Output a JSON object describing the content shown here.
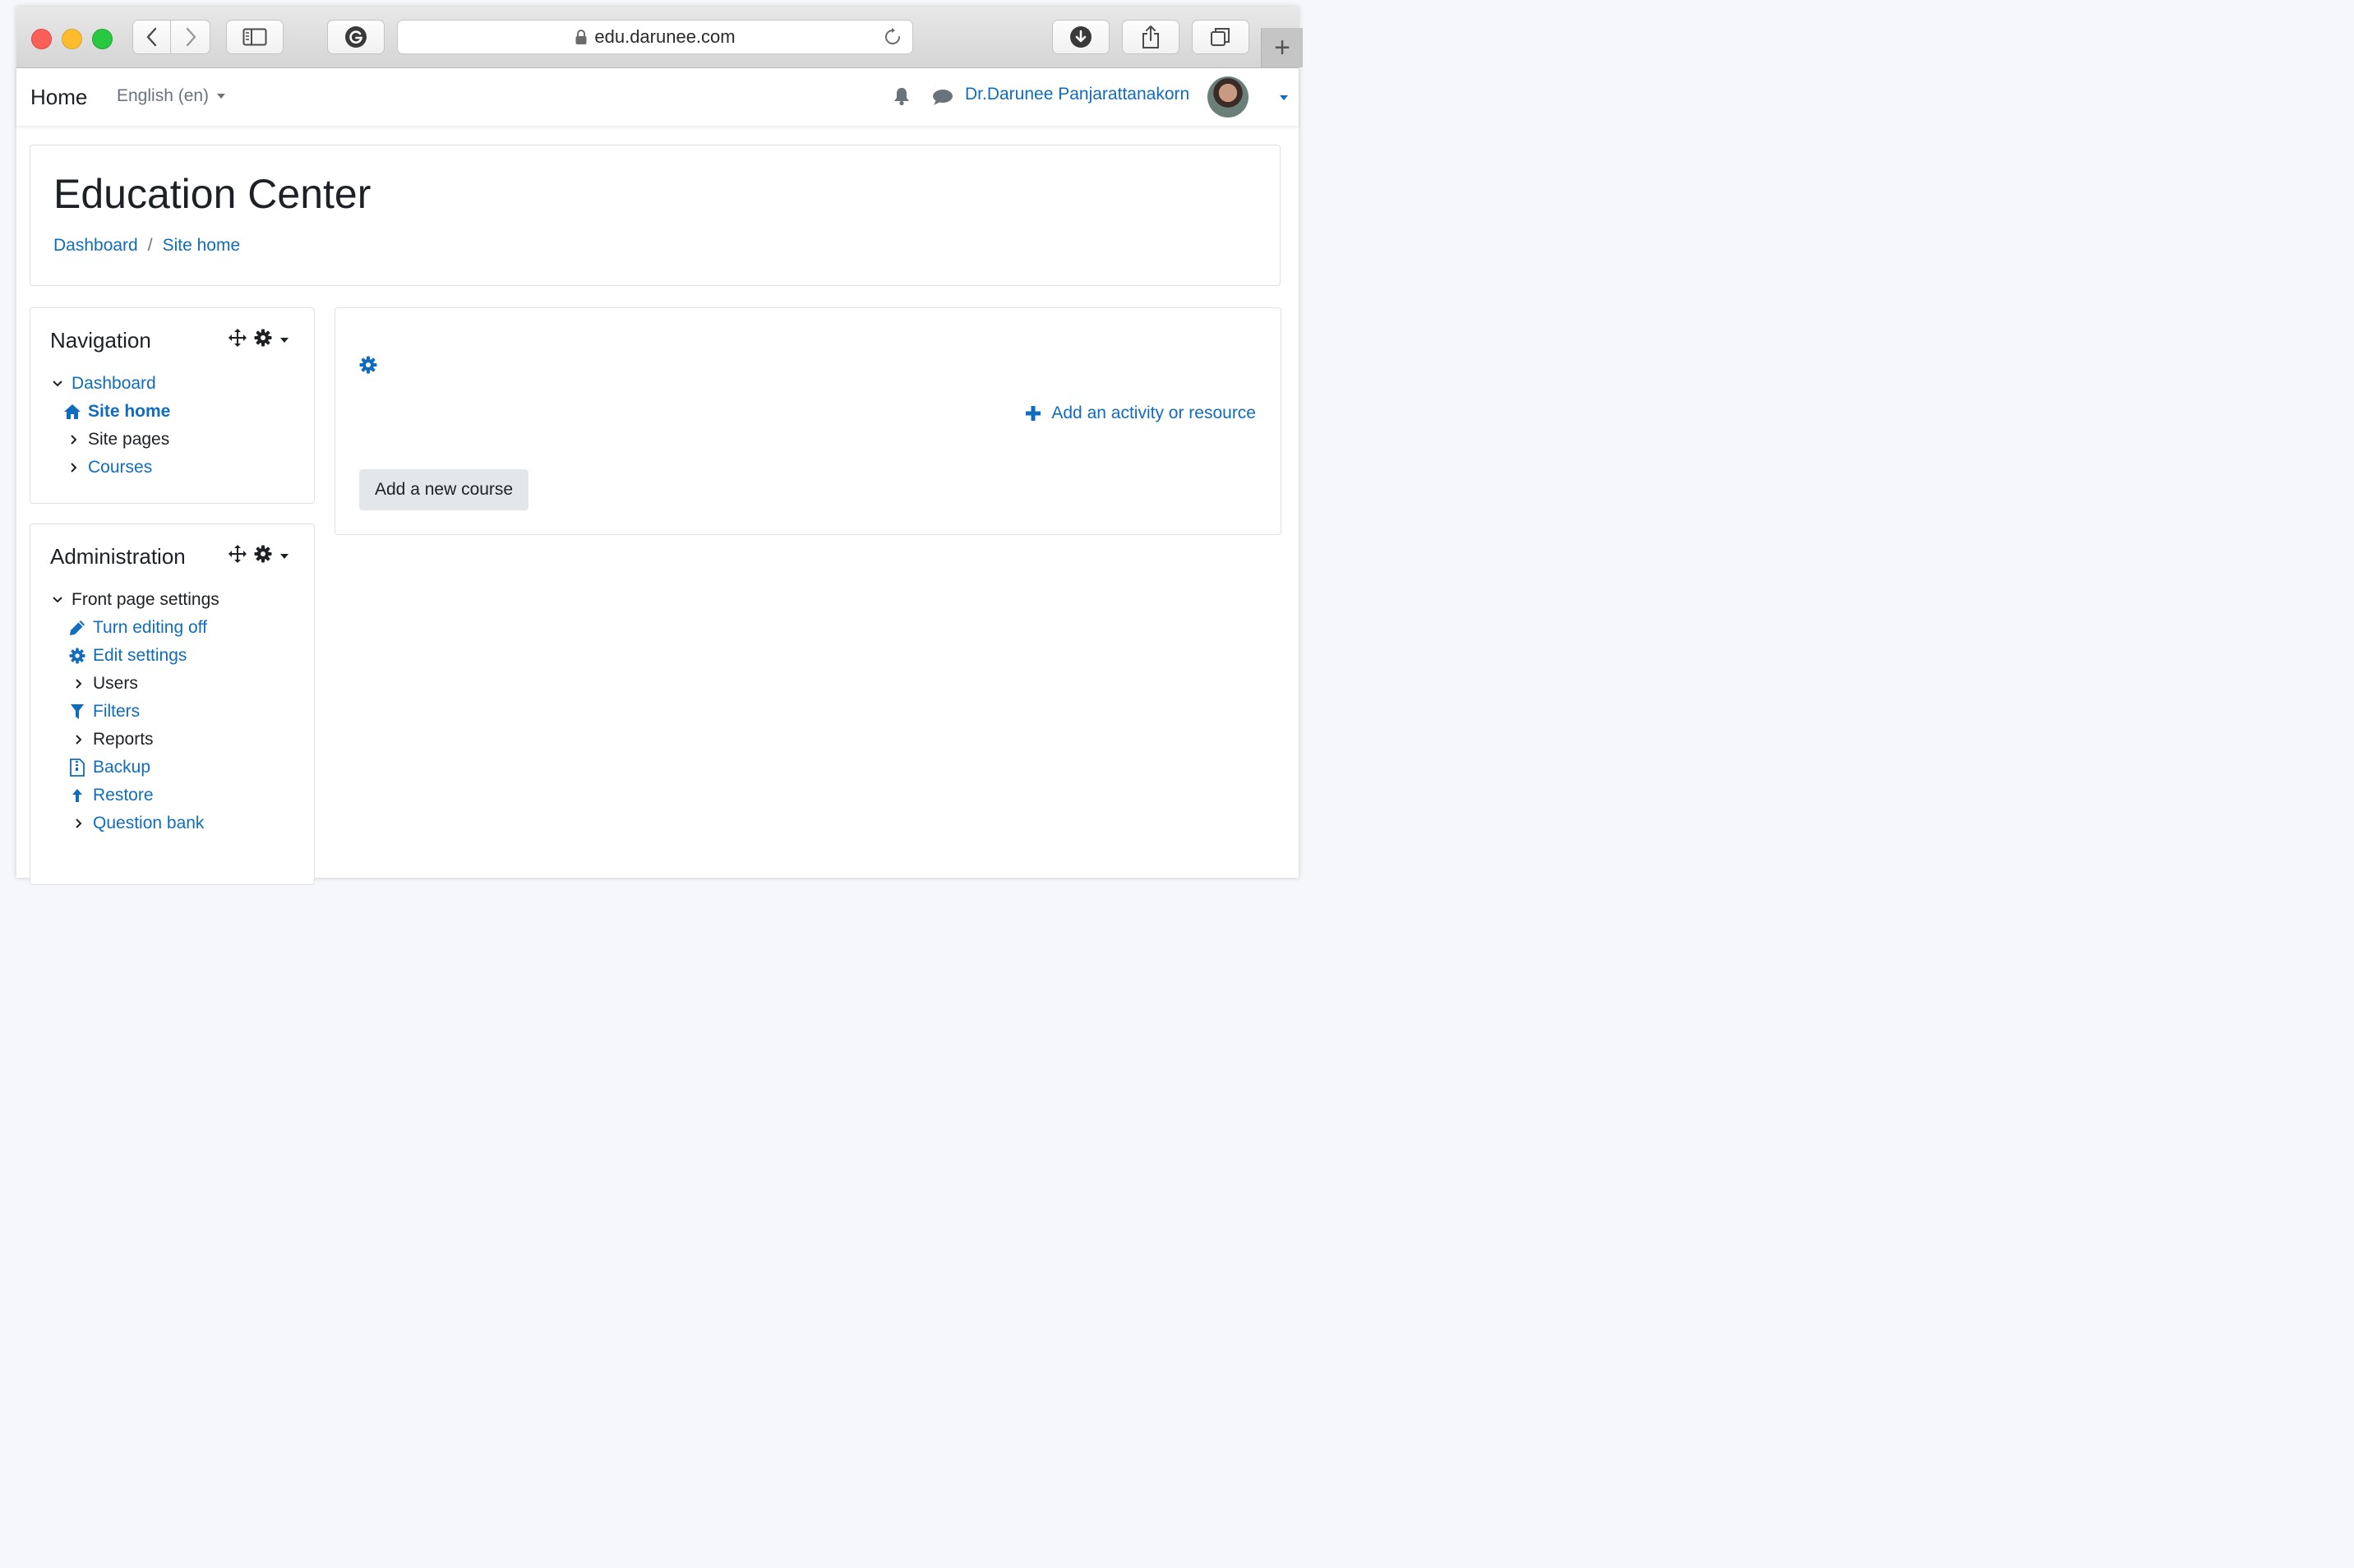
{
  "browser": {
    "url": "edu.darunee.com",
    "new_tab_glyph": "+",
    "icons": [
      "back-icon",
      "forward-icon",
      "sidebar-icon",
      "grammarly-icon",
      "lock-icon",
      "reload-icon",
      "download-icon",
      "share-icon",
      "tabs-icon"
    ]
  },
  "navbar": {
    "home": "Home",
    "language": "English (en)",
    "user_name": "Dr.Darunee Panjarattanakorn",
    "icons": [
      "bell-icon",
      "message-icon",
      "avatar",
      "chevron-down-icon"
    ]
  },
  "header": {
    "title": "Education Center",
    "breadcrumb": [
      {
        "label": "Dashboard"
      },
      {
        "label": "Site home"
      }
    ],
    "separator": "/"
  },
  "navigation_block": {
    "title": "Navigation",
    "items": [
      {
        "label": "Dashboard",
        "icon": "chevron-down-icon"
      },
      {
        "label": "Site home",
        "icon": "home-icon"
      },
      {
        "label": "Site pages",
        "icon": "chevron-right-icon"
      },
      {
        "label": "Courses",
        "icon": "chevron-right-icon"
      }
    ]
  },
  "admin_block": {
    "title": "Administration",
    "items": [
      {
        "label": "Front page settings",
        "icon": "chevron-down-icon"
      },
      {
        "label": "Turn editing off",
        "icon": "pencil-icon"
      },
      {
        "label": "Edit settings",
        "icon": "gear-icon"
      },
      {
        "label": "Users",
        "icon": "chevron-right-icon"
      },
      {
        "label": "Filters",
        "icon": "filter-icon"
      },
      {
        "label": "Reports",
        "icon": "chevron-right-icon"
      },
      {
        "label": "Backup",
        "icon": "backup-icon"
      },
      {
        "label": "Restore",
        "icon": "restore-icon"
      },
      {
        "label": "Question bank",
        "icon": "chevron-right-icon"
      }
    ]
  },
  "main": {
    "add_activity": "Add an activity or resource",
    "add_course": "Add a new course"
  },
  "colors": {
    "link": "#0f6cbf",
    "text": "#1d2125",
    "muted": "#6a737b",
    "border": "#dee2e6"
  }
}
